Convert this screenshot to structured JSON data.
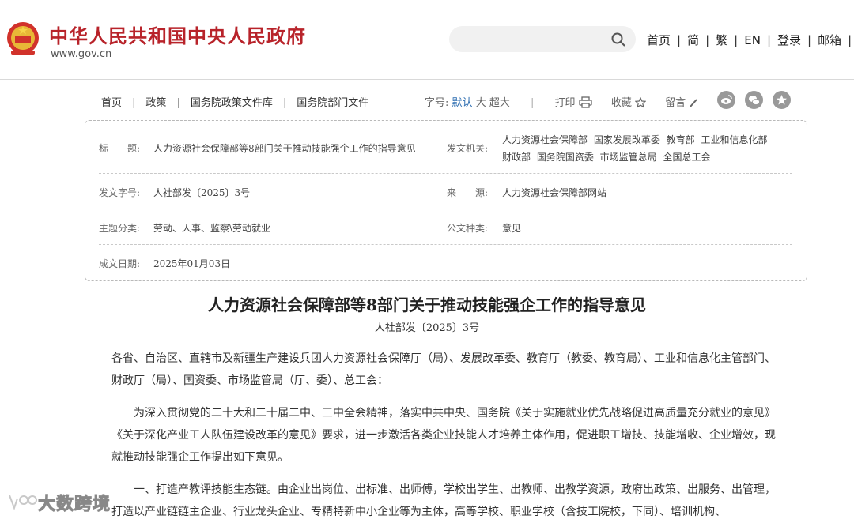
{
  "header": {
    "site_title": "中华人民共和国中央人民政府",
    "site_url": "www.gov.cn",
    "search": {
      "placeholder": ""
    },
    "nav": [
      {
        "label": "首页"
      },
      {
        "label": "简"
      },
      {
        "label": "繁"
      },
      {
        "label": "EN"
      },
      {
        "label": "登录"
      },
      {
        "label": "邮箱"
      }
    ]
  },
  "breadcrumb": [
    "首页",
    "政策",
    "国务院政策文件库",
    "国务院部门文件"
  ],
  "tools": {
    "font_label": "字号:",
    "font_default": "默认",
    "font_large": "大",
    "font_xlarge": "超大",
    "print": "打印",
    "favorite": "收藏",
    "comment": "留言"
  },
  "info": {
    "title_label": "标　　题:",
    "title_value": "人力资源社会保障部等8部门关于推动技能强企工作的指导意见",
    "issuer_label": "发文机关:",
    "issuer_line1": "人力资源社会保障部  国家发展改革委  教育部  工业和信息化部",
    "issuer_line2": "财政部  国务院国资委  市场监管总局  全国总工会",
    "doc_no_label": "发文字号:",
    "doc_no_value": "人社部发〔2025〕3号",
    "source_label": "来　　源:",
    "source_value": "人力资源社会保障部网站",
    "topic_label": "主题分类:",
    "topic_value": "劳动、人事、监察\\劳动就业",
    "type_label": "公文种类:",
    "type_value": "意见",
    "date_label": "成文日期:",
    "date_value": "2025年01月03日"
  },
  "article": {
    "title": "人力资源社会保障部等8部门关于推动技能强企工作的指导意见",
    "doc_no": "人社部发〔2025〕3号",
    "p1": "各省、自治区、直辖市及新疆生产建设兵团人力资源社会保障厅（局）、发展改革委、教育厅（教委、教育局）、工业和信息化主管部门、财政厅（局）、国资委、市场监管局（厅、委）、总工会：",
    "p2": "为深入贯彻党的二十大和二十届二中、三中全会精神，落实中共中央、国务院《关于实施就业优先战略促进高质量充分就业的意见》《关于深化产业工人队伍建设改革的意见》要求，进一步激活各类企业技能人才培养主体作用，促进职工增技、技能增收、企业增效，现就推动技能强企工作提出如下意见。",
    "p3": "一、打造产教评技能生态链。由企业出岗位、出标准、出师傅，学校出学生、出教师、出教学资源，政府出政策、出服务、出管理，打造以产业链链主企业、行业龙头企业、专精特新中小企业等为主体，高等学校、职业学校（含技工院校，下同）、培训机构、"
  },
  "watermark": {
    "text": "大数跨境"
  },
  "colors": {
    "brand_red": "#b8232a",
    "link_blue": "#2b6cb0"
  }
}
